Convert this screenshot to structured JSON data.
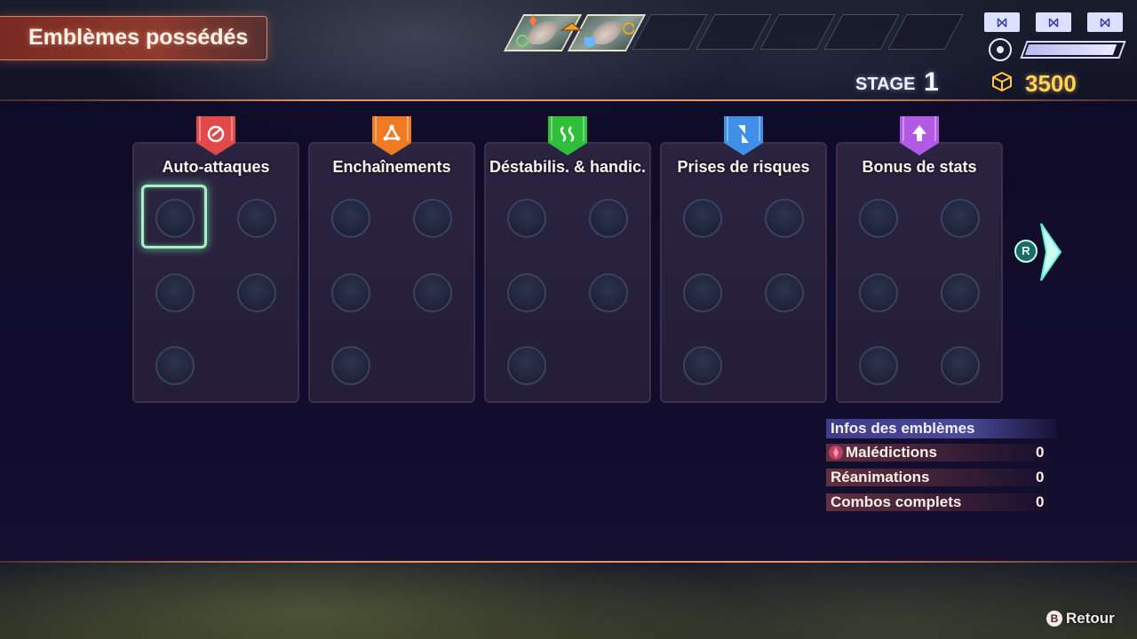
{
  "header": {
    "title": "Emblèmes possédés"
  },
  "party": {
    "members": [
      {
        "name_icon": "party-member-portrait-1",
        "class_color": "#7bd36a"
      },
      {
        "name_icon": "party-member-portrait-2",
        "class_color": "#6ab8ff"
      }
    ],
    "empty_slots": 5
  },
  "hud": {
    "chips": [
      "⨝",
      "⨝",
      "⨝"
    ],
    "gauge_fraction": 0.95,
    "stage_label": "STAGE",
    "stage_number": "1",
    "gold": "3500"
  },
  "categories": [
    {
      "label": "Auto-attaques",
      "banner_color": "#e24a4a",
      "icon": "auto-attack-icon",
      "slots": 5,
      "selected_slot": 0
    },
    {
      "label": "Enchaînements",
      "banner_color": "#f07a22",
      "icon": "chain-icon",
      "slots": 5
    },
    {
      "label": "Déstabilis. & handic.",
      "banner_color": "#2fbf3a",
      "icon": "debuff-icon",
      "slots": 5
    },
    {
      "label": "Prises de risques",
      "banner_color": "#3f8fe6",
      "icon": "risk-icon",
      "slots": 5
    },
    {
      "label": "Bonus de stats",
      "banner_color": "#b25ae6",
      "icon": "stat-up-icon",
      "slots": 6
    }
  ],
  "navigation": {
    "next_button_glyph": "R"
  },
  "info": {
    "title": "Infos des emblèmes",
    "rows": [
      {
        "label": "Malédictions",
        "value": "0",
        "icon": "curse-icon"
      },
      {
        "label": "Réanimations",
        "value": "0"
      },
      {
        "label": "Combos complets",
        "value": "0"
      }
    ]
  },
  "footer": {
    "back_glyph": "B",
    "back_label": "Retour"
  }
}
